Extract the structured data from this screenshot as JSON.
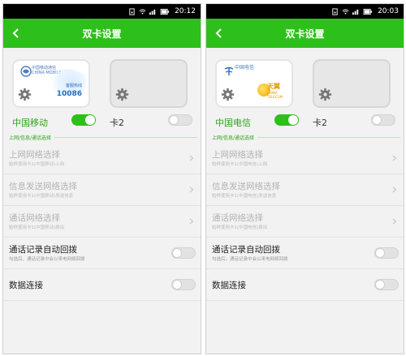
{
  "screens": [
    {
      "status": {
        "time": "20:12"
      },
      "title": "双卡设置",
      "sim1": {
        "carrier_cn": "中国移动通信",
        "carrier_en": "CHINA MOBILE",
        "service_sub": "客服热线",
        "service_number": "10086",
        "label": "中国移动",
        "enabled": true
      },
      "sim2": {
        "label": "卡2",
        "enabled": false
      },
      "section_header": "上网/信息/通话选择",
      "rows": [
        {
          "title": "上网网络选择",
          "subtitle": "始终使用卡1(中国移动)上网"
        },
        {
          "title": "信息发送网络选择",
          "subtitle": "始终使用卡1(中国移动)发送信息"
        },
        {
          "title": "通话网络选择",
          "subtitle": "始终使用卡1(中国移动)拨出"
        },
        {
          "title": "通话记录自动回拨",
          "subtitle": "勾选后，通话记录中会以来电网络回拨"
        },
        {
          "title": "数据连接"
        }
      ]
    },
    {
      "status": {
        "time": "20:03"
      },
      "title": "双卡设置",
      "sim1": {
        "carrier_cn": "中国电信",
        "brand": "天翼",
        "brand_sub": "CHINA TELECOM",
        "label": "中国电信",
        "enabled": true
      },
      "sim2": {
        "label": "卡2",
        "enabled": false
      },
      "section_header": "上网/信息/通话选择",
      "rows": [
        {
          "title": "上网网络选择",
          "subtitle": "始终使用卡1(中国电信)上网"
        },
        {
          "title": "信息发送网络选择",
          "subtitle": "始终使用卡1(中国电信)发送信息"
        },
        {
          "title": "通话网络选择",
          "subtitle": "始终使用卡1(中国电信)拨出"
        },
        {
          "title": "通话记录自动回拨",
          "subtitle": "勾选后，通话记录中会以来电网络回拨"
        },
        {
          "title": "数据连接"
        }
      ]
    }
  ],
  "colors": {
    "accent_green": "#2ec01a",
    "label_green": "#2ba418",
    "status_bar": "#000000",
    "background": "#f2f2f2"
  }
}
